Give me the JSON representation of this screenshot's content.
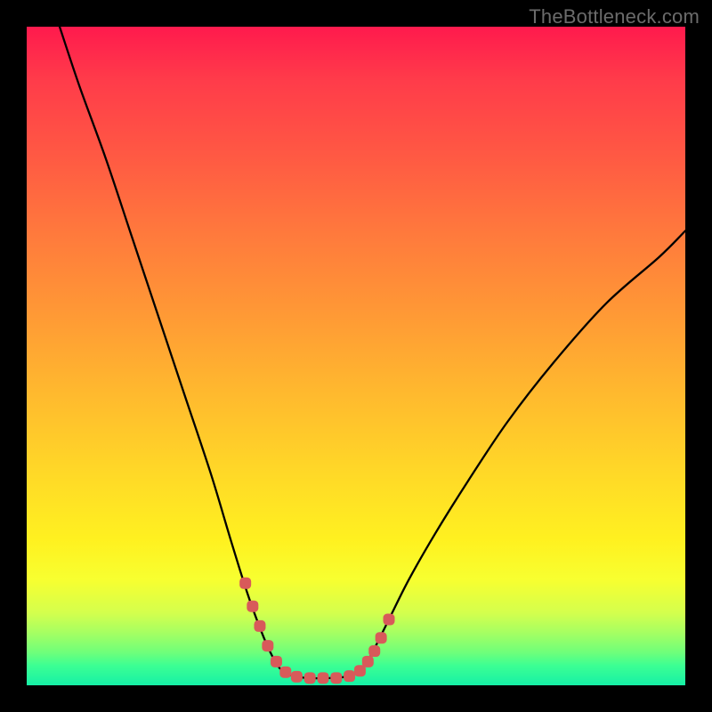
{
  "watermark": "TheBottleneck.com",
  "colors": {
    "page_bg": "#000000",
    "gradient_top": "#ff1a4d",
    "gradient_bottom": "#16f0a6",
    "curve": "#000000",
    "marker": "#d85a5a"
  },
  "chart_data": {
    "type": "line",
    "title": "",
    "xlabel": "",
    "ylabel": "",
    "xlim": [
      0,
      100
    ],
    "ylim": [
      0,
      100
    ],
    "grid": false,
    "series": [
      {
        "name": "curve",
        "x": [
          5,
          8,
          12,
          16,
          20,
          24,
          28,
          31,
          33.5,
          35.5,
          37,
          38.5,
          40.5,
          43,
          46,
          49,
          51,
          52.5,
          55,
          58,
          62,
          67,
          73,
          80,
          88,
          96,
          100
        ],
        "y": [
          100,
          91,
          80,
          68,
          56,
          44,
          32,
          22,
          14,
          8.5,
          5,
          2.5,
          1.4,
          1.1,
          1.1,
          1.4,
          2.5,
          5,
          10,
          16,
          23,
          31,
          40,
          49,
          58,
          65,
          69
        ]
      }
    ],
    "markers": {
      "name": "highlight",
      "color": "#d85a5a",
      "points": [
        {
          "x": 33.2,
          "y": 15.5
        },
        {
          "x": 34.3,
          "y": 12.0
        },
        {
          "x": 35.4,
          "y": 9.0
        },
        {
          "x": 36.6,
          "y": 6.0
        },
        {
          "x": 37.9,
          "y": 3.6
        },
        {
          "x": 39.3,
          "y": 2.0
        },
        {
          "x": 41.0,
          "y": 1.3
        },
        {
          "x": 43.0,
          "y": 1.1
        },
        {
          "x": 45.0,
          "y": 1.1
        },
        {
          "x": 47.0,
          "y": 1.1
        },
        {
          "x": 49.0,
          "y": 1.4
        },
        {
          "x": 50.6,
          "y": 2.2
        },
        {
          "x": 51.8,
          "y": 3.6
        },
        {
          "x": 52.8,
          "y": 5.2
        },
        {
          "x": 53.8,
          "y": 7.2
        },
        {
          "x": 55.0,
          "y": 10.0
        }
      ]
    }
  }
}
